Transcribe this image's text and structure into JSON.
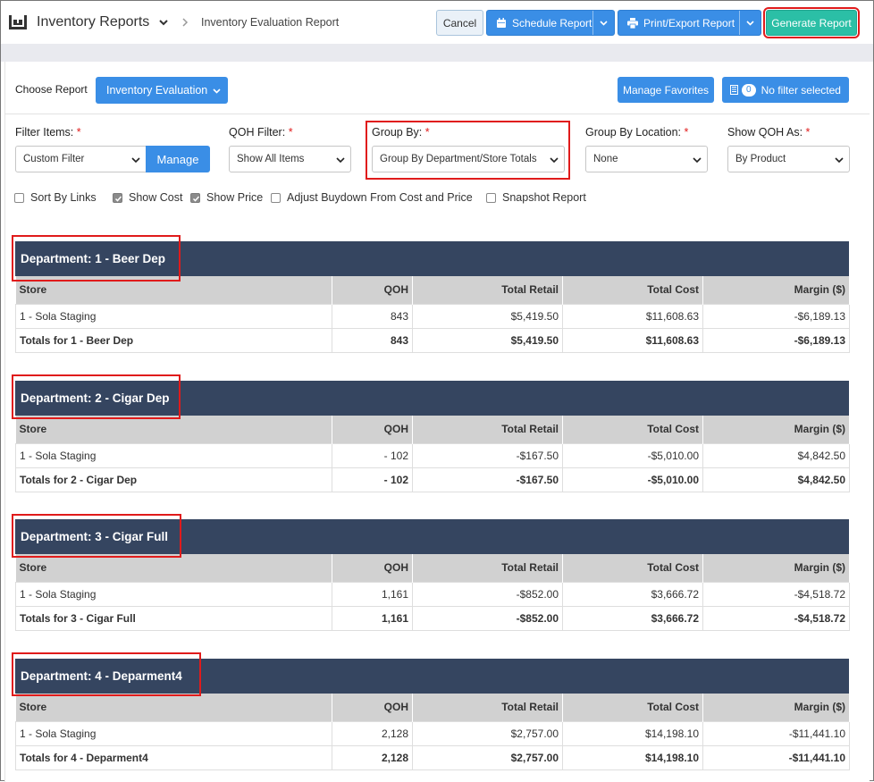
{
  "header": {
    "app_title": "Inventory Reports",
    "breadcrumb": "Inventory Evaluation Report",
    "cancel_label": "Cancel",
    "schedule_label": "Schedule Report",
    "print_label": "Print/Export Report",
    "generate_label": "Generate Report"
  },
  "toolbar": {
    "choose_label": "Choose Report",
    "report_selected": "Inventory Evaluation",
    "favorites_label": "Manage Favorites",
    "filter_count": "0",
    "filter_label": "No filter selected"
  },
  "filters": {
    "filter_items": {
      "label": "Filter Items:",
      "value": "Custom Filter",
      "manage_label": "Manage"
    },
    "qoh_filter": {
      "label": "QOH Filter:",
      "value": "Show All Items"
    },
    "group_by": {
      "label": "Group By:",
      "value": "Group By Department/Store Totals"
    },
    "group_by_location": {
      "label": "Group By Location:",
      "value": "None"
    },
    "show_qoh_as": {
      "label": "Show QOH As:",
      "value": "By Product"
    },
    "required_mark": "*"
  },
  "options": [
    {
      "label": "Sort By Links",
      "checked": false
    },
    {
      "label": "Show Cost",
      "checked": true
    },
    {
      "label": "Show Price",
      "checked": true
    },
    {
      "label": "Adjust Buydown From Cost and Price",
      "checked": false
    },
    {
      "label": "Snapshot Report",
      "checked": false
    }
  ],
  "columns": [
    "Store",
    "QOH",
    "Total Retail",
    "Total Cost",
    "Margin ($)"
  ],
  "departments": [
    {
      "title": "Department: 1 - Beer Dep",
      "row": [
        "1 - Sola Staging",
        "843",
        "$5,419.50",
        "$11,608.63",
        "-$6,189.13"
      ],
      "totals": [
        "Totals for 1 - Beer Dep",
        "843",
        "$5,419.50",
        "$11,608.63",
        "-$6,189.13"
      ]
    },
    {
      "title": "Department: 2 - Cigar Dep",
      "row": [
        "1 - Sola Staging",
        "- 102",
        "-$167.50",
        "-$5,010.00",
        "$4,842.50"
      ],
      "totals": [
        "Totals for 2 - Cigar Dep",
        "- 102",
        "-$167.50",
        "-$5,010.00",
        "$4,842.50"
      ]
    },
    {
      "title": "Department: 3 - Cigar Full",
      "row": [
        "1 - Sola Staging",
        "1,161",
        "-$852.00",
        "$3,666.72",
        "-$4,518.72"
      ],
      "totals": [
        "Totals for 3 - Cigar Full",
        "1,161",
        "-$852.00",
        "$3,666.72",
        "-$4,518.72"
      ]
    },
    {
      "title": "Department: 4 - Deparment4",
      "row": [
        "1 - Sola Staging",
        "2,128",
        "$2,757.00",
        "$14,198.10",
        "-$11,441.10"
      ],
      "totals": [
        "Totals for 4 - Deparment4",
        "2,128",
        "$2,757.00",
        "$14,198.10",
        "-$11,441.10"
      ]
    }
  ],
  "colors": {
    "accent": "#3a8ee6",
    "generate": "#2bbfa6",
    "dept_header": "#354560",
    "highlight": "#e01b1b"
  }
}
